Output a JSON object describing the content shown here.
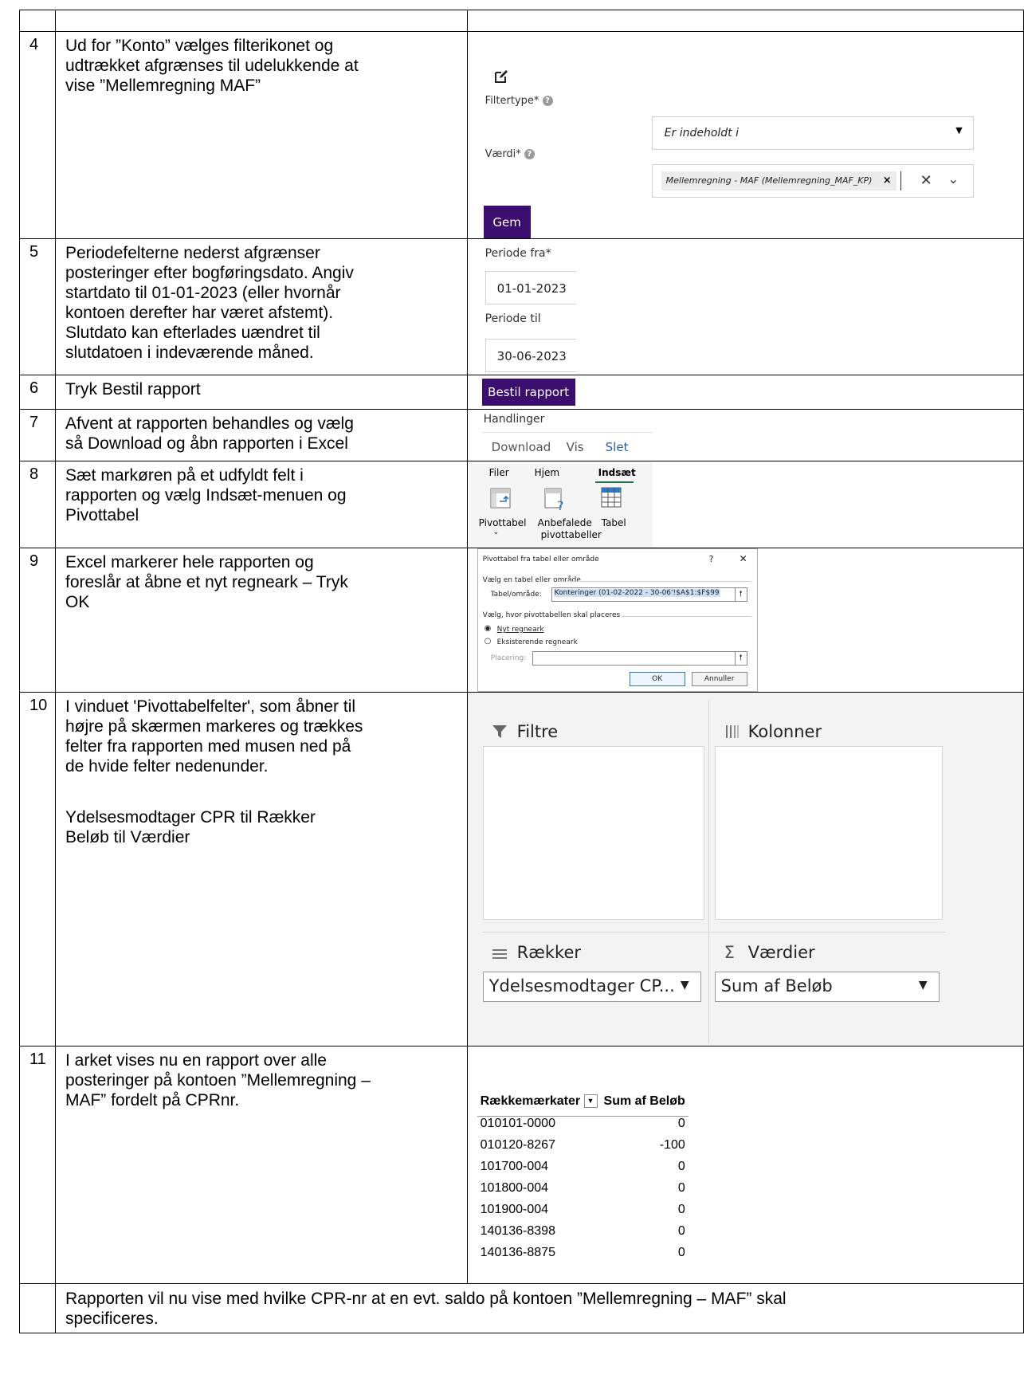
{
  "rows": [
    {
      "num": "4",
      "lines": [
        "Ud for ”Konto” vælges filterikonet og",
        "udtrækket afgrænses til udelukkende at",
        "vise ”Mellemregning MAF”"
      ]
    },
    {
      "num": "5",
      "lines": [
        "Periodefelterne nederst afgrænser",
        "posteringer efter bogføringsdato. Angiv",
        "startdato til 01-01-2023 (eller hvornår",
        "kontoen derefter har været afstemt).",
        "Slutdato kan efterlades uændret til",
        "slutdatoen i indeværende måned."
      ]
    },
    {
      "num": "6",
      "lines": [
        "Tryk Bestil rapport"
      ]
    },
    {
      "num": "7",
      "lines": [
        "Afvent at rapporten behandles og vælg",
        "så Download og åbn rapporten i Excel"
      ]
    },
    {
      "num": "8",
      "lines": [
        "Sæt markøren på et udfyldt felt i",
        "rapporten og vælg Indsæt-menuen og",
        "Pivottabel"
      ]
    },
    {
      "num": "9",
      "lines": [
        "Excel markerer hele rapporten og",
        "foreslår at åbne et nyt regneark – Tryk",
        "OK"
      ]
    },
    {
      "num": "10",
      "lines": [
        "I vinduet 'Pivottabelfelter', som åbner til",
        "højre på skærmen markeres og trækkes",
        "felter fra rapporten med musen ned på",
        "de hvide felter nedenunder.",
        "",
        "Ydelsesmodtager CPR til Rækker",
        "Beløb til Værdier"
      ]
    },
    {
      "num": "11",
      "lines": [
        "I arket vises nu en rapport over alle",
        "posteringer på kontoen ”Mellemregning –",
        "MAF” fordelt på CPRnr."
      ]
    }
  ],
  "footer": [
    "Rapporten vil nu vise med hvilke CPR-nr at en evt. saldo på kontoen ”Mellemregning – MAF” skal",
    "specificeres."
  ],
  "filter": {
    "type_label": "Filtertype*",
    "type_value": "Er indeholdt i",
    "value_label": "Værdi*",
    "chip": "Mellemregning - MAF (Mellemregning_MAF_KP)",
    "save": "Gem"
  },
  "period": {
    "from_label": "Periode fra*",
    "from_value": "01-01-2023",
    "to_label": "Periode til",
    "to_value": "30-06-2023"
  },
  "order_button": "Bestil rapport",
  "actions": {
    "title": "Handlinger",
    "download": "Download",
    "view": "Vis",
    "delete": "Slet"
  },
  "ribbon": {
    "tabs": [
      "Filer",
      "Hjem",
      "Indsæt"
    ],
    "pivot": "Pivottabel",
    "recommended": [
      "Anbefalede",
      "pivottabeller"
    ],
    "table": "Tabel"
  },
  "dialog": {
    "title": "Pivottabel fra tabel eller område",
    "help": "?",
    "close": "✕",
    "section1": "Vælg en tabel eller område",
    "range_label": "Tabel/område:",
    "range_value": "Konteringer (01-02-2022 - 30-06'!$A$1:$F$99",
    "section2": "Vælg, hvor pivottabellen skal placeres",
    "opt_new": "Nyt regneark",
    "opt_existing": "Eksisterende regneark",
    "place_label": "Placering:",
    "ok": "OK",
    "cancel": "Annuller"
  },
  "pivot_fields": {
    "filters": "Filtre",
    "columns": "Kolonner",
    "rows": "Rækker",
    "values": "Værdier",
    "rows_field": "Ydelsesmodtager CP...",
    "values_field": "Sum af Beløb"
  },
  "pivot_table": {
    "header": [
      "Rækkemærkater",
      "Sum af Beløb"
    ],
    "rows": [
      [
        "010101-0000",
        "0"
      ],
      [
        "010120-8267",
        "-100"
      ],
      [
        "101700-004",
        "0"
      ],
      [
        "101800-004",
        "0"
      ],
      [
        "101900-004",
        "0"
      ],
      [
        "140136-8398",
        "0"
      ],
      [
        "140136-8875",
        "0"
      ]
    ]
  }
}
